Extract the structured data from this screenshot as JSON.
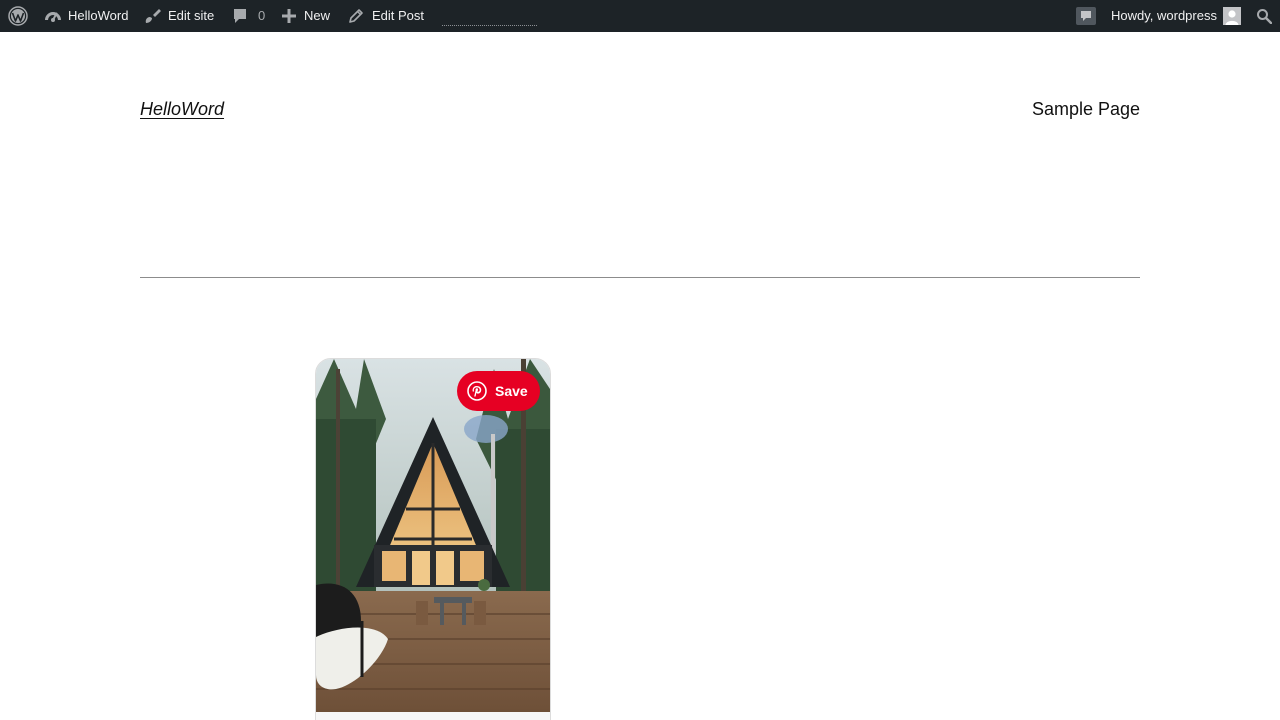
{
  "admin_bar": {
    "site_name": "HelloWord",
    "edit_site": "Edit site",
    "comments_count": "0",
    "new_label": "New",
    "edit_post": "Edit Post",
    "howdy": "Howdy, wordpress",
    "icons": [
      "wordpress-logo-icon",
      "dashboard-icon",
      "brush-icon",
      "comment-icon",
      "plus-icon",
      "pencil-icon",
      "notification-icon",
      "avatar",
      "search-icon"
    ]
  },
  "header": {
    "site_title": "HelloWord",
    "nav": [
      "Sample Page"
    ]
  },
  "pin": {
    "save_label": "Save",
    "icon": "pinterest-icon",
    "brand_color": "#e60023"
  },
  "colors": {
    "admin_bar_bg": "#1d2327",
    "admin_bar_text": "#f0f0f1",
    "separator": "#8c8c8c"
  }
}
